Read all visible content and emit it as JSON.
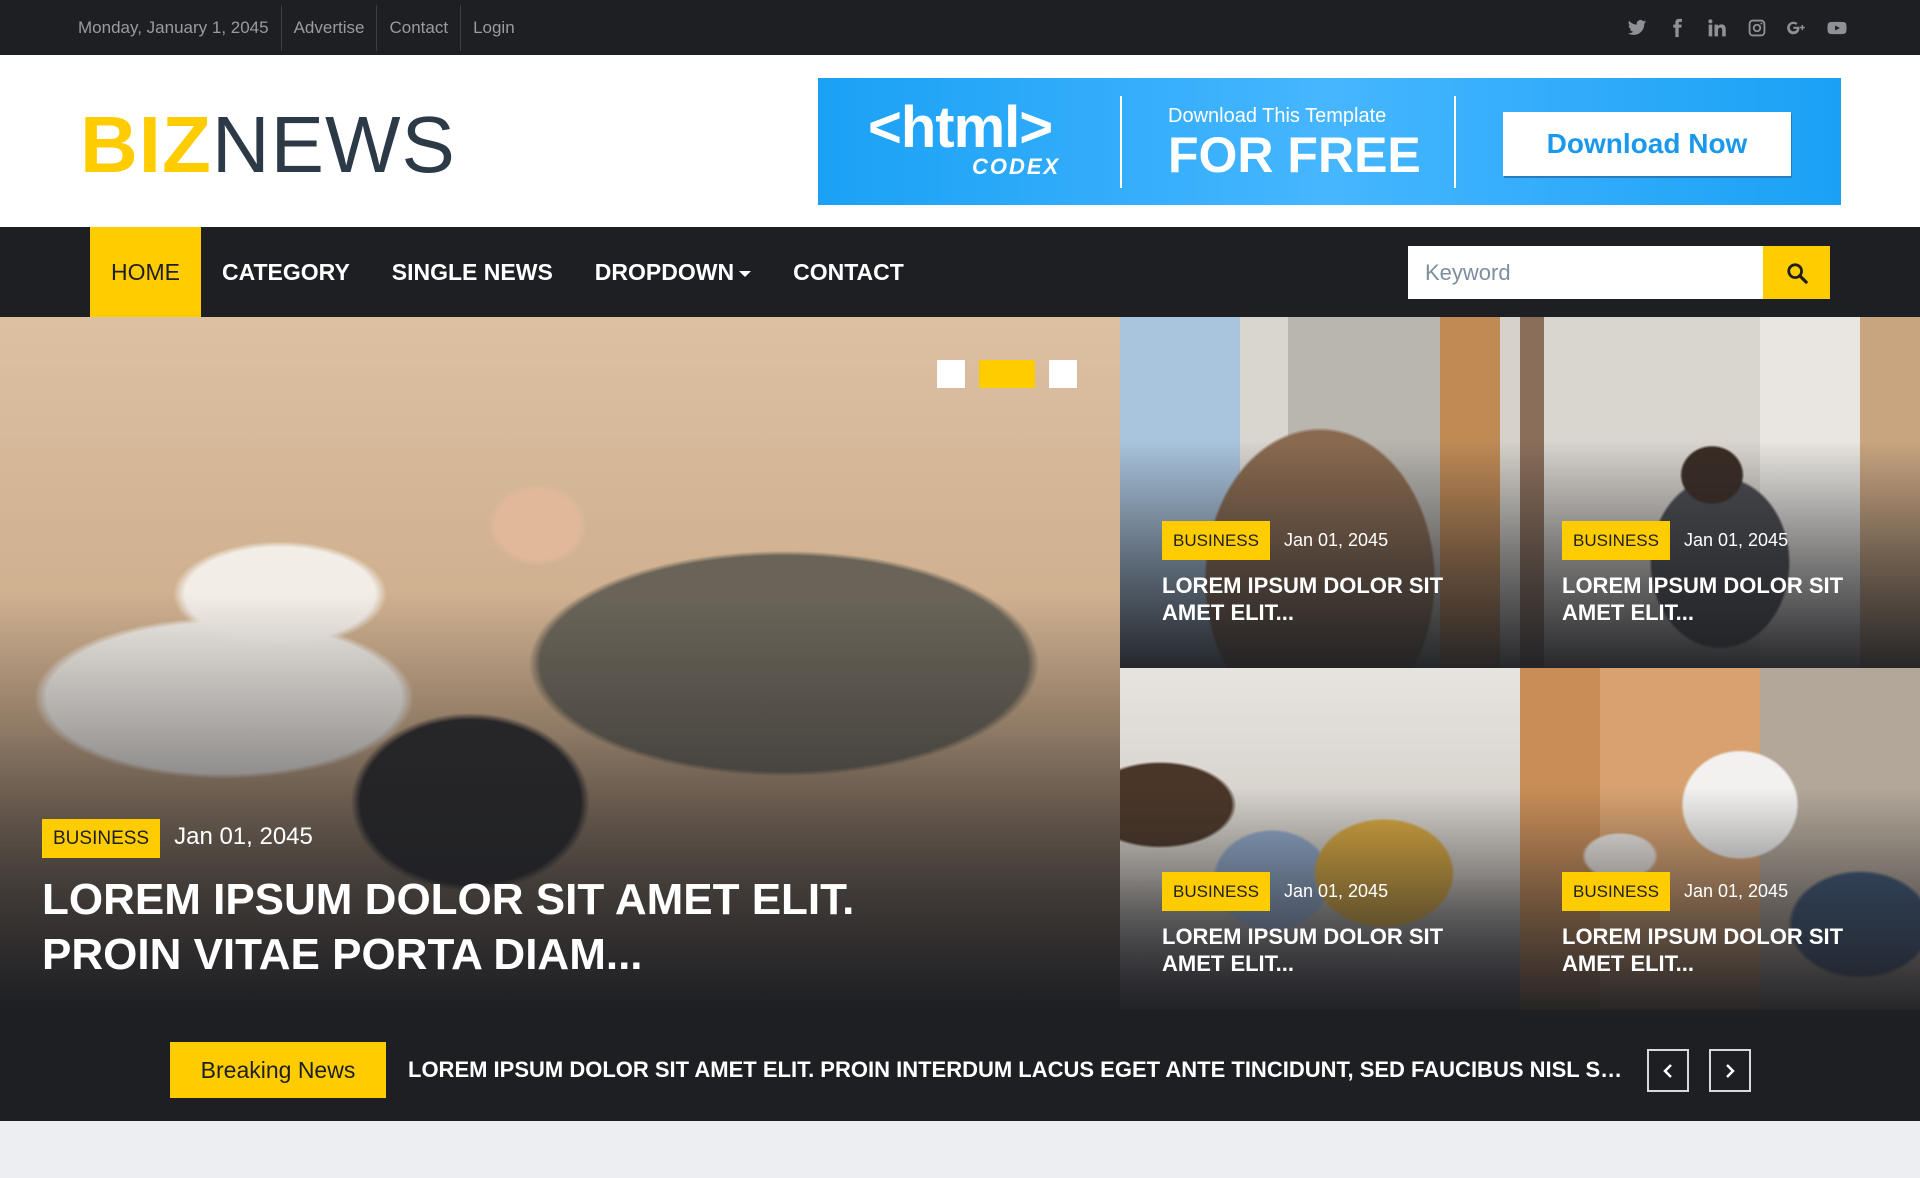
{
  "topbar": {
    "date": "Monday, January 1, 2045",
    "links": [
      "Advertise",
      "Contact",
      "Login"
    ],
    "social_icons": [
      "twitter-icon",
      "facebook-icon",
      "linkedin-icon",
      "instagram-icon",
      "google-plus-icon",
      "youtube-icon"
    ]
  },
  "header": {
    "logo_part1": "BIZ",
    "logo_part2": "NEWS",
    "banner": {
      "brand": "<html>",
      "brand_sub": "CODEX",
      "line1": "Download This Template",
      "line2": "FOR FREE",
      "button": "Download Now"
    }
  },
  "nav": {
    "items": [
      {
        "label": "HOME",
        "active": true
      },
      {
        "label": "CATEGORY"
      },
      {
        "label": "SINGLE NEWS"
      },
      {
        "label": "DROPDOWN",
        "dropdown": true
      },
      {
        "label": "CONTACT"
      }
    ],
    "search": {
      "placeholder": "Keyword",
      "value": ""
    }
  },
  "hero": {
    "carousel": {
      "slides": 3,
      "active_index": 1
    },
    "main": {
      "category": "BUSINESS",
      "date": "Jan 01, 2045",
      "title_line1": "LOREM IPSUM DOLOR SIT AMET ELIT.",
      "title_line2": "PROIN VITAE PORTA DIAM..."
    },
    "tiles": [
      {
        "category": "BUSINESS",
        "date": "Jan 01, 2045",
        "title_line1": "LOREM IPSUM DOLOR SIT",
        "title_line2": "AMET ELIT..."
      },
      {
        "category": "BUSINESS",
        "date": "Jan 01, 2045",
        "title_line1": "LOREM IPSUM DOLOR SIT",
        "title_line2": "AMET ELIT..."
      },
      {
        "category": "BUSINESS",
        "date": "Jan 01, 2045",
        "title_line1": "LOREM IPSUM DOLOR SIT",
        "title_line2": "AMET ELIT..."
      },
      {
        "category": "BUSINESS",
        "date": "Jan 01, 2045",
        "title_line1": "LOREM IPSUM DOLOR SIT",
        "title_line2": "AMET ELIT..."
      }
    ]
  },
  "breaking": {
    "label": "Breaking News",
    "headline": "LOREM IPSUM DOLOR SIT AMET ELIT. PROIN INTERDUM LACUS EGET ANTE TINCIDUNT, SED FAUCIBUS NISL SODALES"
  },
  "colors": {
    "accent": "#ffcc00",
    "dark": "#1e1f23",
    "banner_blue": "#1aa1f5",
    "page_bg": "#edeef2"
  }
}
